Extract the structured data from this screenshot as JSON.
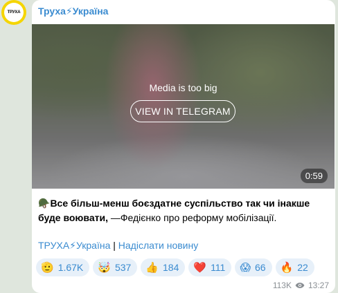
{
  "channel": {
    "name": "Труха⚡Україна",
    "avatar_text": "ТРУХА"
  },
  "media": {
    "notice": "Media is too big",
    "button_label": "VIEW IN TELEGRAM",
    "duration": "0:59"
  },
  "post": {
    "emoji": "🪖",
    "bold_text": "Все більш-менш боєздатне суспільство так чи інакше буде воювати,",
    "rest_text": " —Федієнко про реформу мобілізації."
  },
  "links": {
    "channel_link": "ТРУХА⚡Україна",
    "separator": " | ",
    "submit_link": "Надіслати новину"
  },
  "reactions": [
    {
      "emoji": "🫡",
      "icon": "salute-face-icon",
      "count": "1.67K"
    },
    {
      "emoji": "🤯",
      "icon": "exploding-head-icon",
      "count": "537"
    },
    {
      "emoji": "👍",
      "icon": "thumbs-up-icon",
      "count": "184"
    },
    {
      "emoji": "❤️",
      "icon": "heart-icon",
      "count": "111"
    },
    {
      "emoji": "😱",
      "icon": "screaming-face-icon",
      "count": "66"
    },
    {
      "emoji": "🔥",
      "icon": "fire-icon",
      "count": "22"
    }
  ],
  "meta": {
    "views": "113K",
    "time": "13:27"
  },
  "colors": {
    "link": "#3a8bd0",
    "avatar_ring": "#f5d500",
    "background": "#dfe6dd"
  }
}
